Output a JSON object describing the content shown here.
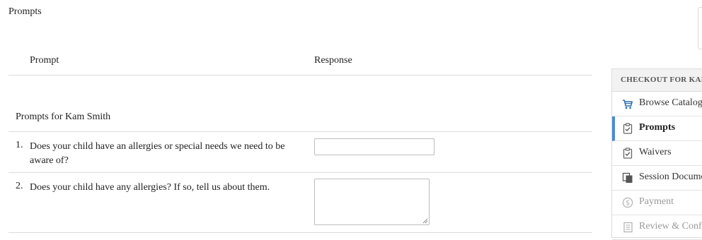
{
  "section": {
    "title": "Prompts"
  },
  "table": {
    "col_prompt": "Prompt",
    "col_response": "Response",
    "group_title": "Prompts for Kam Smith",
    "questions": [
      {
        "num": "1.",
        "text": "Does your child have an allergies or special needs we need to be aware of?",
        "value": ""
      },
      {
        "num": "2.",
        "text": "Does your child have any allergies? If so, tell us about them.",
        "value": ""
      }
    ]
  },
  "sidebar": {
    "header": "CHECKOUT FOR KAM",
    "items": [
      {
        "label": "Browse Catalog",
        "icon": "cart-icon"
      },
      {
        "label": "Prompts",
        "icon": "clipboard-check-icon",
        "state": "active"
      },
      {
        "label": "Waivers",
        "icon": "clipboard-check-icon"
      },
      {
        "label": "Session Documents",
        "icon": "documents-icon"
      },
      {
        "label": "Payment",
        "icon": "dollar-circle-icon",
        "state": "disabled"
      },
      {
        "label": "Review & Confirm",
        "icon": "receipt-icon",
        "state": "disabled"
      }
    ]
  },
  "colors": {
    "accent": "#4a8ad4",
    "icon_active": "#2e6fb5",
    "icon_disabled": "#b5b5b5"
  }
}
